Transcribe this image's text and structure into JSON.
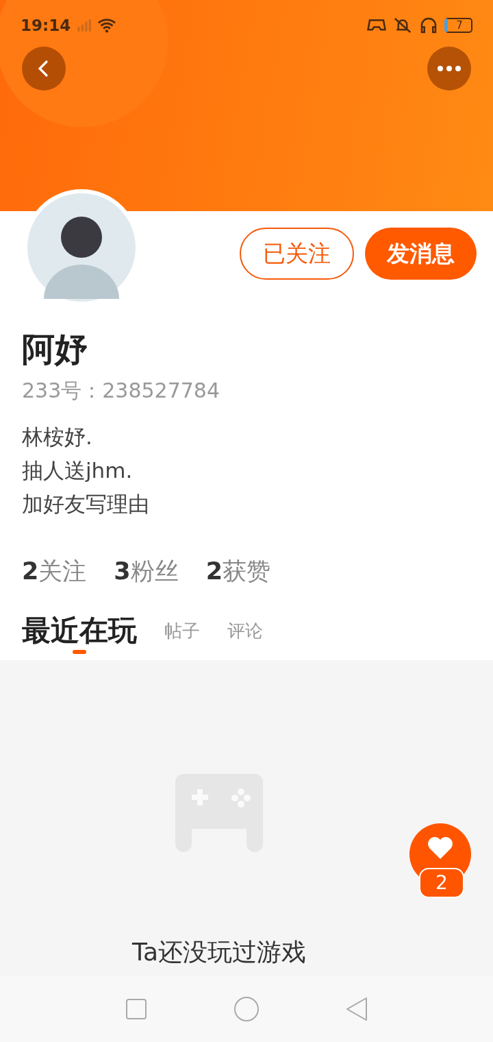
{
  "status_bar": {
    "time": "19:14",
    "battery": "7"
  },
  "profile": {
    "name": "阿妤",
    "id_line": "233号：238527784",
    "bio": [
      "林桉妤.",
      "抽人送jhm.",
      "加好友写理由"
    ]
  },
  "actions": [
    {
      "kind": "outline",
      "label": "已关注"
    },
    {
      "kind": "filled",
      "label": "发消息"
    }
  ],
  "stats": [
    {
      "count": "2",
      "label": "关注"
    },
    {
      "count": "3",
      "label": "粉丝"
    },
    {
      "count": "2",
      "label": "获赞"
    }
  ],
  "tabs": [
    {
      "label": "最近在玩",
      "selected": true
    },
    {
      "label": "帖子",
      "selected": false
    },
    {
      "label": "评论",
      "selected": false
    }
  ],
  "empty_state": {
    "message": "Ta还没玩过游戏"
  },
  "like_button": {
    "count": "2"
  }
}
